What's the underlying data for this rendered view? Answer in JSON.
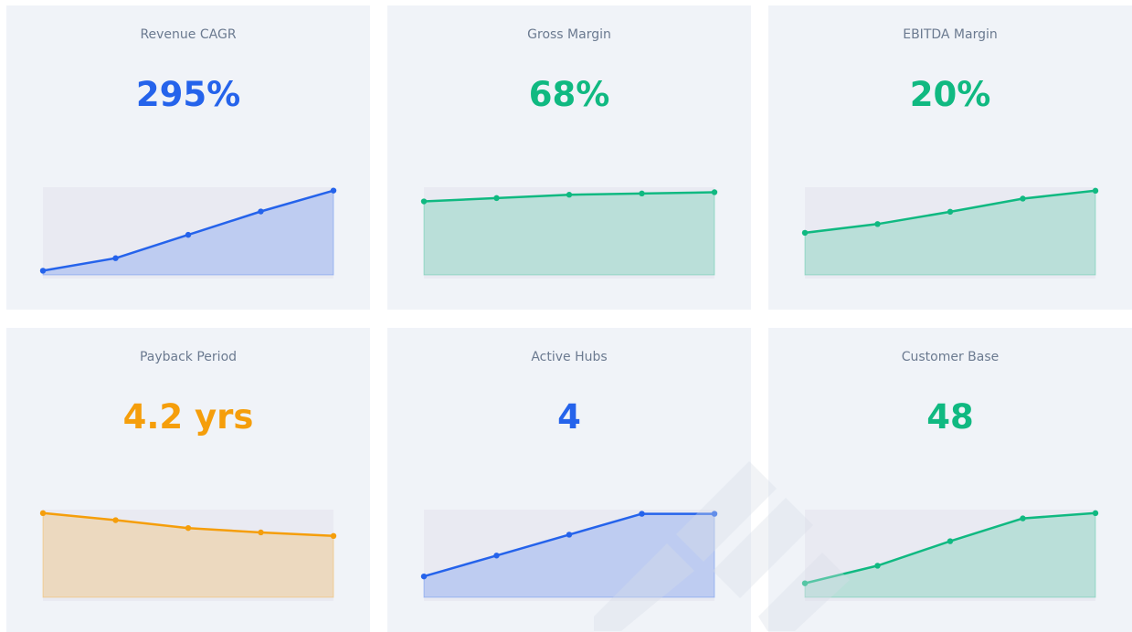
{
  "colors": {
    "blue": "#2563eb",
    "green": "#10b981",
    "orange": "#f59e0b",
    "card_bg": "#f0f3f8",
    "plot_bg": "#e9eaf2",
    "title": "#6b7a90"
  },
  "chart_data": [
    {
      "type": "area",
      "title": "Revenue CAGR",
      "value": "295%",
      "color": "#2563eb",
      "values": [
        5,
        20,
        48,
        76,
        101
      ],
      "ylim": [
        0,
        105
      ]
    },
    {
      "type": "area",
      "title": "Gross Margin",
      "value": "68%",
      "color": "#10b981",
      "values": [
        88,
        92,
        96,
        97.5,
        99
      ],
      "ylim": [
        0,
        105
      ]
    },
    {
      "type": "area",
      "title": "EBITDA Margin",
      "value": "20%",
      "color": "#10b981",
      "values": [
        48,
        58,
        72,
        87,
        96
      ],
      "ylim": [
        0,
        100
      ]
    },
    {
      "type": "area",
      "title": "Payback Period",
      "value": "4.2 yrs",
      "color": "#f59e0b",
      "values": [
        96,
        88,
        79,
        74,
        70
      ],
      "ylim": [
        0,
        100
      ]
    },
    {
      "type": "area",
      "title": "Active Hubs",
      "value": "4",
      "color": "#2563eb",
      "values": [
        1,
        2,
        3,
        4,
        4
      ],
      "ylim": [
        0,
        4.2
      ]
    },
    {
      "type": "area",
      "title": "Customer Base",
      "value": "48",
      "color": "#10b981",
      "values": [
        16,
        36,
        64,
        90,
        96
      ],
      "ylim": [
        0,
        100
      ]
    }
  ]
}
